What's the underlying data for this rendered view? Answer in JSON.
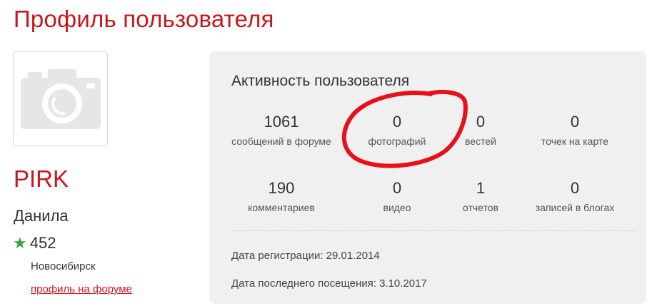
{
  "page": {
    "title": "Профиль пользователя"
  },
  "profile": {
    "username": "PIRK",
    "real_name": "Данила",
    "rating": "452",
    "city": "Новосибирск",
    "forum_link": "профиль на форуме",
    "avatar_icon": "camera-placeholder-icon",
    "rating_icon": "star-icon",
    "rating_icon_color": "#3aa23a"
  },
  "activity": {
    "title": "Активность пользователя",
    "stats": [
      {
        "value": "1061",
        "label": "сообщений в форуме"
      },
      {
        "value": "0",
        "label": "фотографий"
      },
      {
        "value": "0",
        "label": "вестей"
      },
      {
        "value": "0",
        "label": "точек на карте"
      },
      {
        "value": "190",
        "label": "комментариев"
      },
      {
        "value": "0",
        "label": "видео"
      },
      {
        "value": "1",
        "label": "отчетов"
      },
      {
        "value": "0",
        "label": "записей в блогах"
      }
    ],
    "registration": "Дата регистрации: 29.01.2014",
    "last_visit": "Дата последнего посещения: 3.10.2017"
  },
  "colors": {
    "accent": "#c8161d",
    "card_background": "#f0f0f0",
    "annotation": "#e8101a"
  }
}
